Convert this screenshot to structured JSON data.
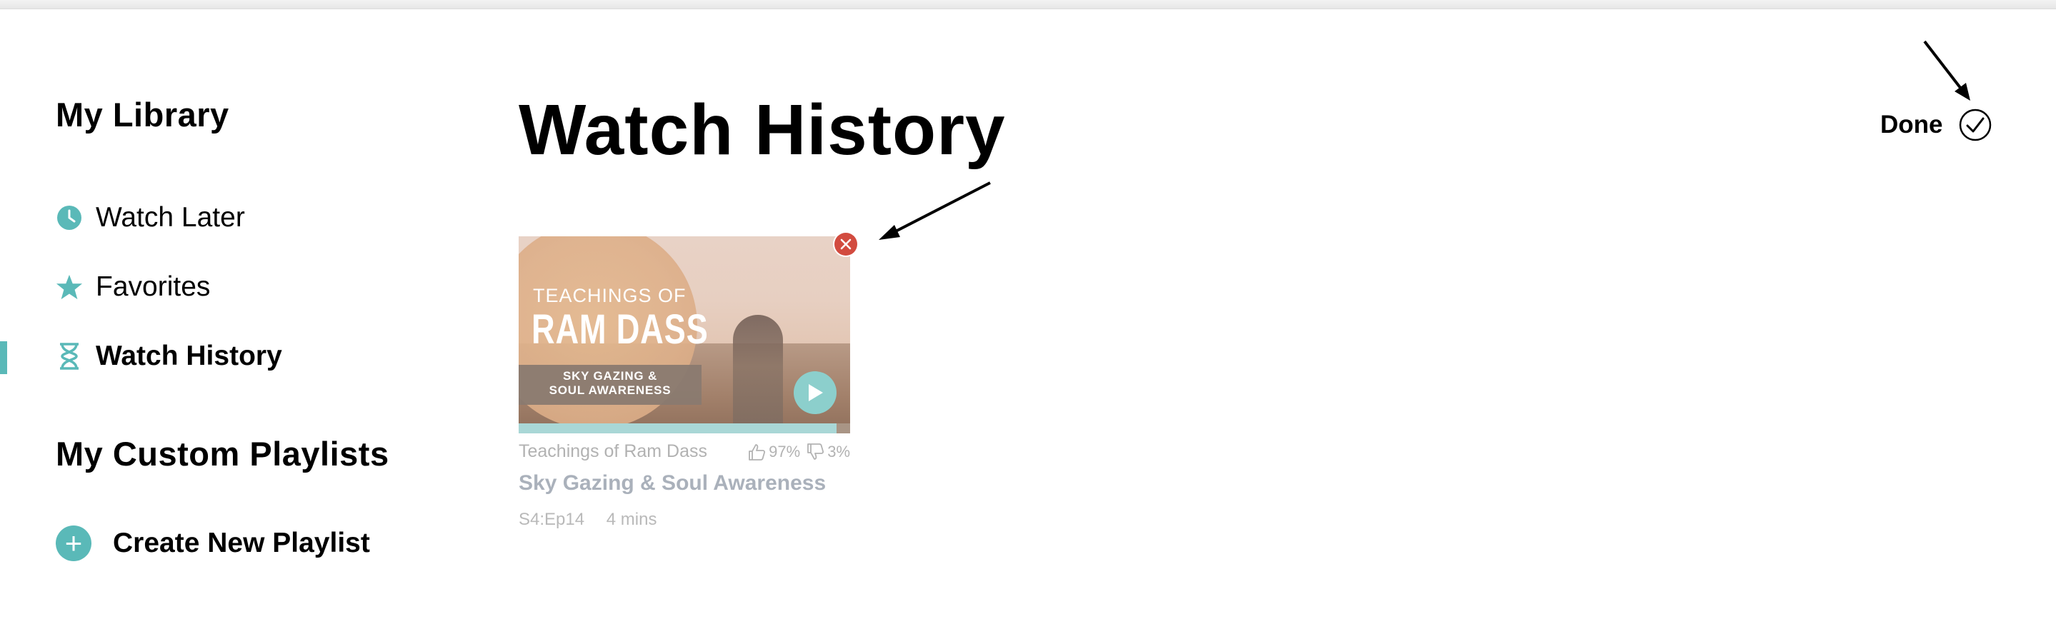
{
  "sidebar": {
    "library_title": "My Library",
    "items": [
      {
        "label": "Watch Later",
        "icon": "clock-icon"
      },
      {
        "label": "Favorites",
        "icon": "star-icon"
      },
      {
        "label": "Watch History",
        "icon": "hourglass-icon",
        "active": true
      }
    ],
    "playlists_title": "My Custom Playlists",
    "create_playlist_label": "Create New Playlist"
  },
  "main": {
    "title": "Watch History",
    "done_label": "Done",
    "cards": [
      {
        "thumb_line1": "TEACHINGS OF",
        "thumb_line2": "RAM DASS",
        "thumb_line3": "SKY GAZING &",
        "thumb_line4": "SOUL AWARENESS",
        "series": "Teachings of Ram Dass",
        "likes": "97%",
        "dislikes": "3%",
        "episode_title": "Sky Gazing & Soul Awareness",
        "episode_code": "S4:Ep14",
        "duration": "4 mins",
        "progress": 0.96
      }
    ]
  },
  "colors": {
    "accent": "#5ab9b8",
    "remove": "#d24b3f",
    "muted_text": "#b2b2b2"
  }
}
